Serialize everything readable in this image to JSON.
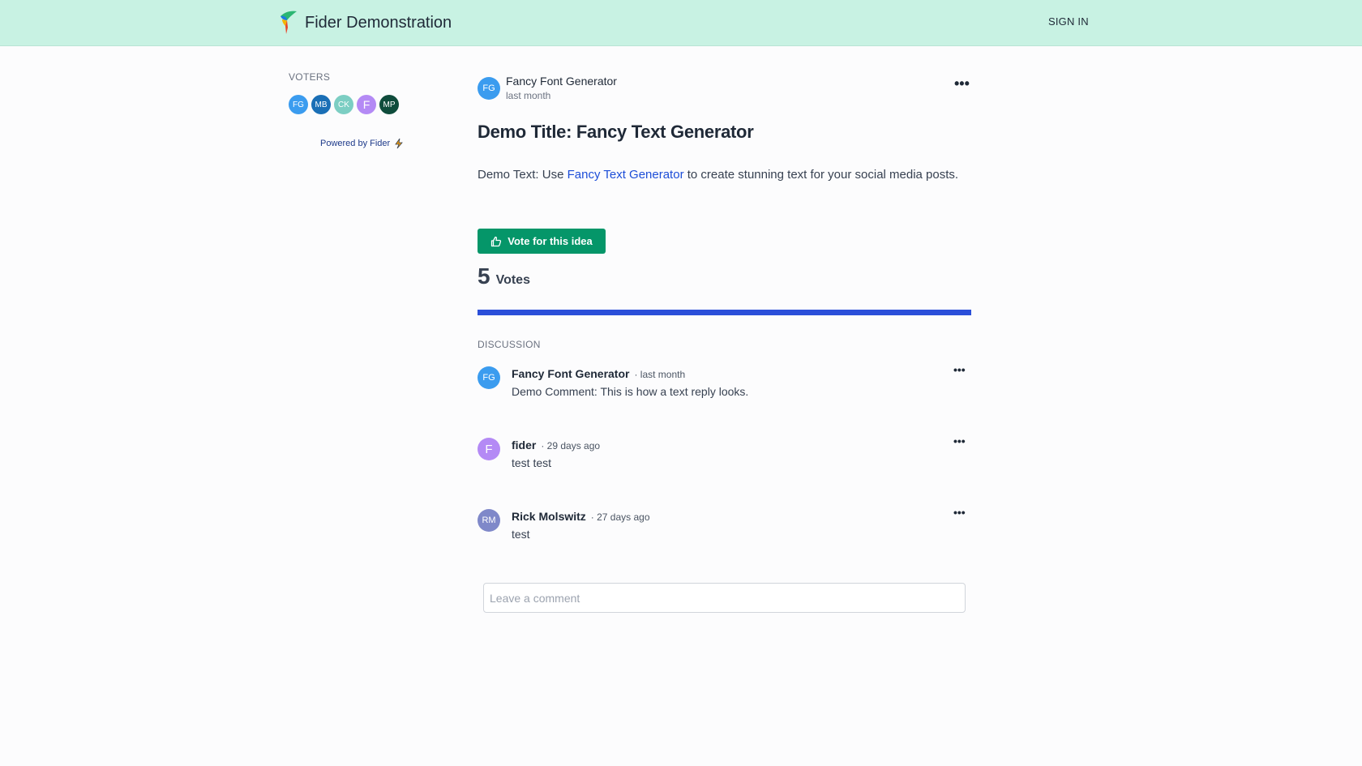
{
  "header": {
    "title": "Fider Demonstration",
    "sign_in": "SIGN IN",
    "logo_icon": "fider-logo-icon",
    "background": "#c8f2e3"
  },
  "sidebar": {
    "voters_title": "VOTERS",
    "voters": [
      {
        "initials": "FG",
        "color": "#3b9cef"
      },
      {
        "initials": "MB",
        "color": "#1a6fb6"
      },
      {
        "initials": "CK",
        "color": "#7ccec3"
      },
      {
        "initials": "F",
        "color": "#b48af5"
      },
      {
        "initials": "MP",
        "color": "#0f4c3c"
      }
    ],
    "powered_by": "Powered by Fider",
    "powered_icon": "lightning-bolt-icon"
  },
  "post": {
    "author": {
      "initials": "FG",
      "name": "Fancy Font Generator",
      "time": "last month",
      "color": "#3b9cef"
    },
    "more": "•••",
    "title": "Demo Title: Fancy Text Generator",
    "description": {
      "before": "Demo Text: Use ",
      "link": "Fancy Text Generator",
      "after": " to create stunning text for your social media posts."
    },
    "vote_button": "Vote for this idea",
    "vote_icon": "thumbs-up-icon",
    "votes_count": "5",
    "votes_label": "Votes",
    "vote_progress_percent": 100,
    "accent_color": "#059669",
    "progress_color": "#2b4fd9"
  },
  "discussion": {
    "title": "DISCUSSION",
    "comments": [
      {
        "initials": "FG",
        "name": "Fancy Font Generator",
        "time": "· last month",
        "body": "Demo Comment: This is how a text reply looks.",
        "more": "•••",
        "color": "#3b9cef"
      },
      {
        "initials": "F",
        "name": "fider",
        "time": "· 29 days ago",
        "body": "test test",
        "more": "•••",
        "color": "#b48af5"
      },
      {
        "initials": "RM",
        "name": "Rick Molswitz",
        "time": "· 27 days ago",
        "body": "test",
        "more": "•••",
        "color": "#7f88c9"
      }
    ],
    "comment_placeholder": "Leave a comment"
  }
}
